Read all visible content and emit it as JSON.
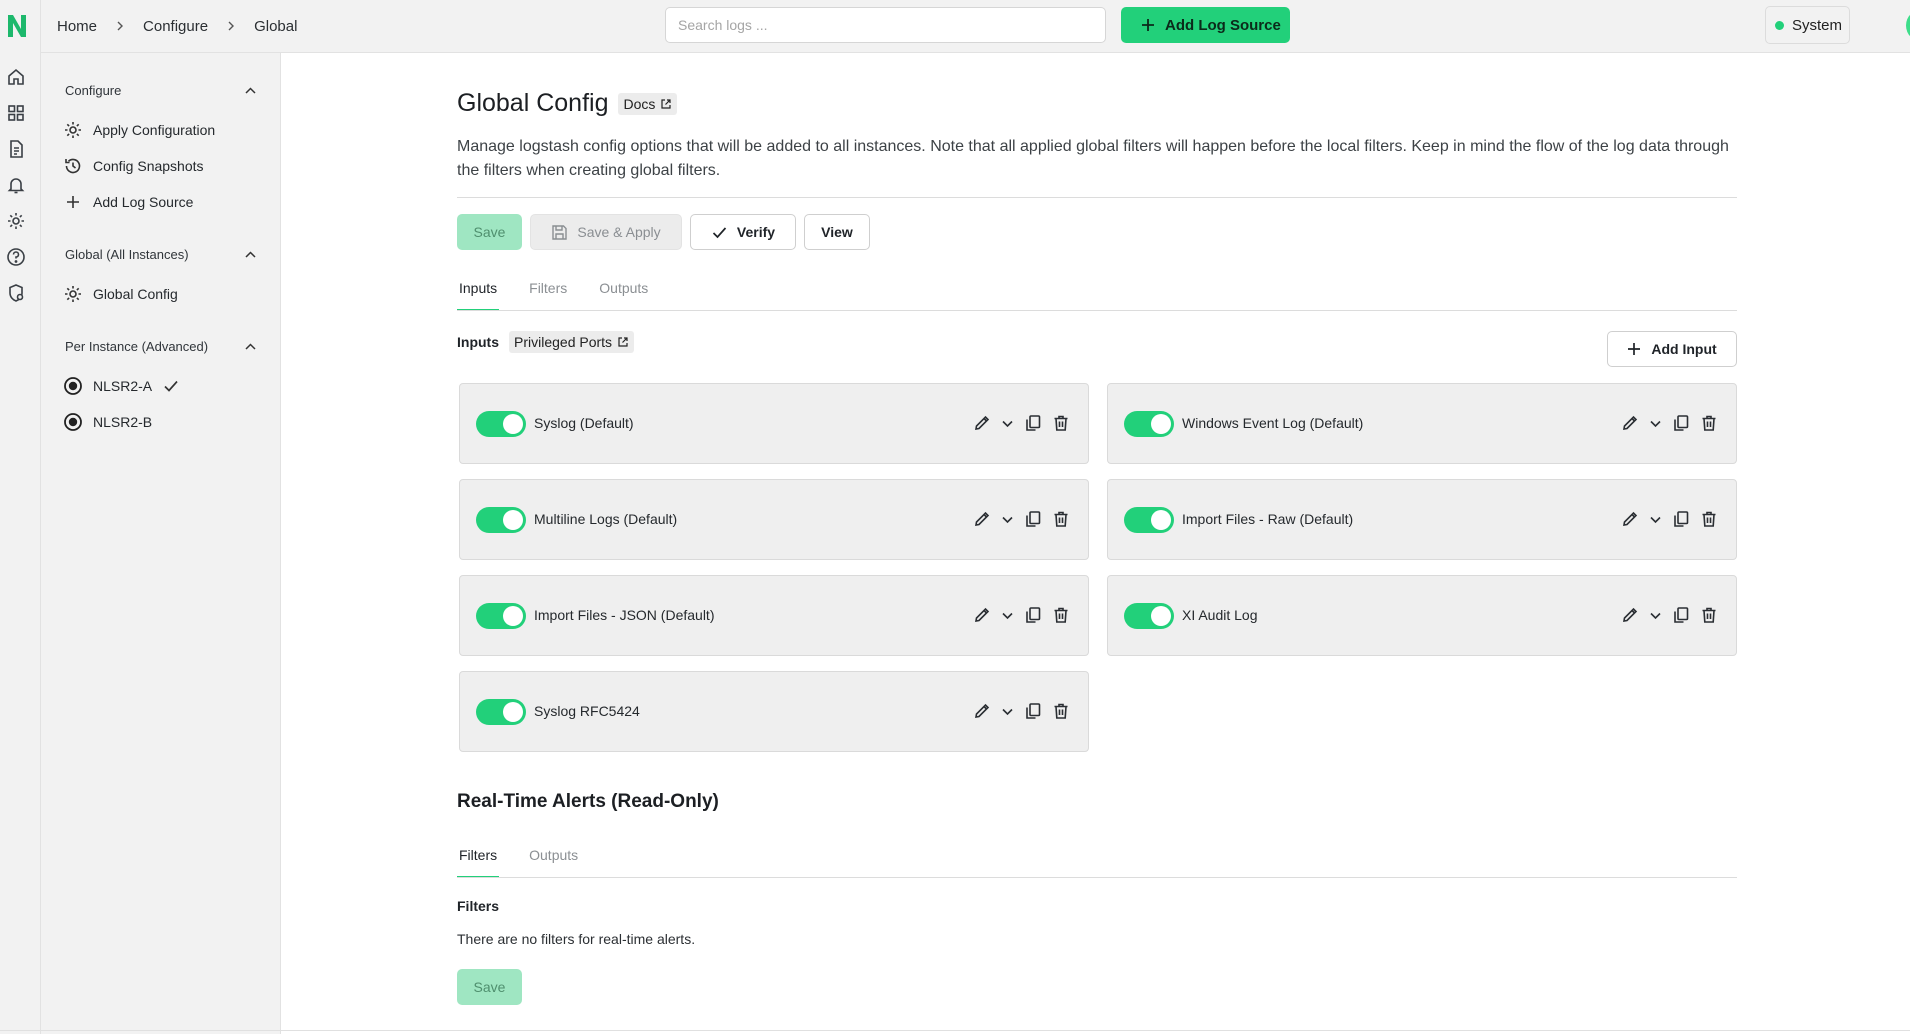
{
  "header": {
    "breadcrumb": [
      "Home",
      "Configure",
      "Global"
    ],
    "search_placeholder": "Search logs ...",
    "add_log_source": "Add Log Source",
    "system_label": "System"
  },
  "rail": {
    "icons": [
      "home-icon",
      "dashboard-icon",
      "document-icon",
      "bell-icon",
      "gear-icon",
      "help-icon",
      "shield-icon"
    ]
  },
  "sidebar": {
    "sections": [
      {
        "title": "Configure",
        "items": [
          "Apply Configuration",
          "Config Snapshots",
          "Add Log Source"
        ]
      },
      {
        "title": "Global (All Instances)",
        "items": [
          "Global Config"
        ]
      },
      {
        "title": "Per Instance (Advanced)",
        "items": [
          "NLSR2-A",
          "NLSR2-B"
        ]
      }
    ]
  },
  "main": {
    "title": "Global Config",
    "docs_label": "Docs",
    "description": "Manage logstash config options that will be added to all instances. Note that all applied global filters will happen before the local filters. Keep in mind the flow of the log data through the filters when creating global filters.",
    "buttons": {
      "save": "Save",
      "save_apply": "Save & Apply",
      "verify": "Verify",
      "view": "View"
    },
    "tabs": [
      "Inputs",
      "Filters",
      "Outputs"
    ],
    "inputs_label": "Inputs",
    "privileged_ports": "Privileged Ports",
    "add_input": "Add Input",
    "inputs": [
      {
        "label": "Syslog (Default)",
        "enabled": true
      },
      {
        "label": "Windows Event Log (Default)",
        "enabled": true
      },
      {
        "label": "Multiline Logs (Default)",
        "enabled": true
      },
      {
        "label": "Import Files - Raw (Default)",
        "enabled": true
      },
      {
        "label": "Import Files - JSON (Default)",
        "enabled": true
      },
      {
        "label": "XI Audit Log",
        "enabled": true
      },
      {
        "label": "Syslog RFC5424",
        "enabled": true
      }
    ],
    "alerts": {
      "title": "Real-Time Alerts (Read-Only)",
      "tabs": [
        "Filters",
        "Outputs"
      ],
      "filters_heading": "Filters",
      "empty_text": "There are no filters for real-time alerts.",
      "save": "Save"
    }
  },
  "colors": {
    "accent": "#22d07a",
    "accent_disabled": "#9fe6c2"
  }
}
